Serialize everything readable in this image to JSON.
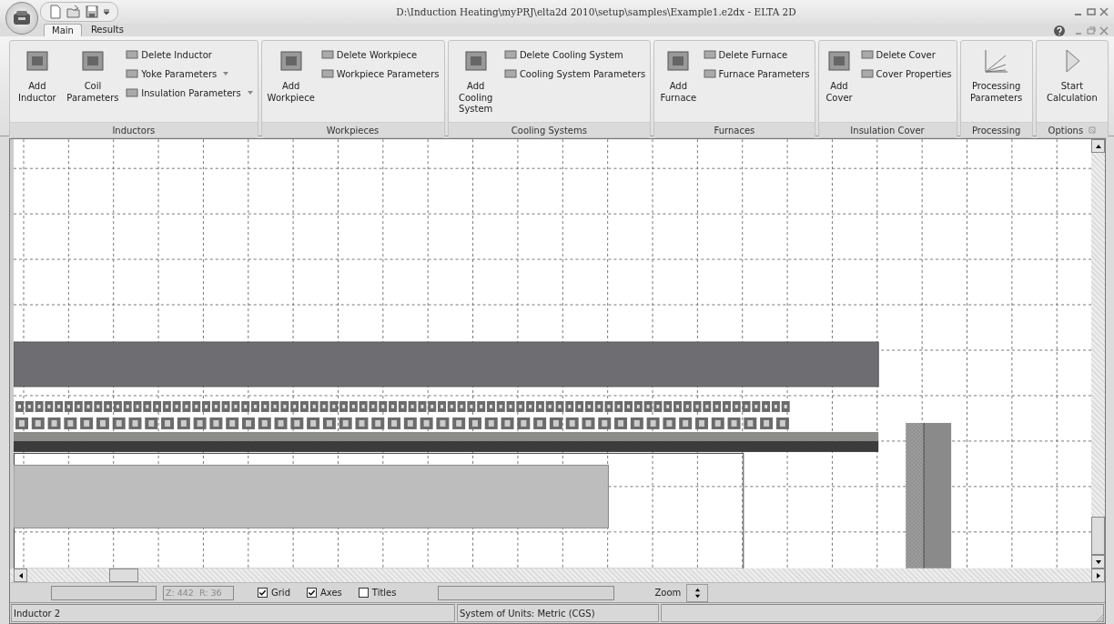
{
  "window": {
    "title": "D:\\Induction Heating\\myPRJ\\elta2d 2010\\setup\\samples\\Example1.e2dx - ELTA 2D"
  },
  "tabs": [
    {
      "label": "Main",
      "selected": true
    },
    {
      "label": "Results",
      "selected": false
    }
  ],
  "ribbon": [
    {
      "name": "Inductors",
      "items": [
        {
          "kind": "large",
          "label": "Add Inductor"
        },
        {
          "kind": "large",
          "label": "Coil Parameters"
        },
        {
          "kind": "small",
          "label": "Delete Inductor",
          "dropdown": false
        },
        {
          "kind": "small",
          "label": "Yoke Parameters",
          "dropdown": true
        },
        {
          "kind": "small",
          "label": "Insulation Parameters",
          "dropdown": true
        }
      ]
    },
    {
      "name": "Workpieces",
      "items": [
        {
          "kind": "large",
          "label": "Add Workpiece"
        },
        {
          "kind": "small",
          "label": "Delete Workpiece",
          "dropdown": false
        },
        {
          "kind": "small",
          "label": "Workpiece Parameters",
          "dropdown": false
        }
      ]
    },
    {
      "name": "Cooling Systems",
      "items": [
        {
          "kind": "large",
          "label": "Add Cooling System"
        },
        {
          "kind": "small",
          "label": "Delete Cooling System",
          "dropdown": false
        },
        {
          "kind": "small",
          "label": "Cooling System Parameters",
          "dropdown": false
        }
      ]
    },
    {
      "name": "Furnaces",
      "items": [
        {
          "kind": "large",
          "label": "Add Furnace"
        },
        {
          "kind": "small",
          "label": "Delete Furnace",
          "dropdown": false
        },
        {
          "kind": "small",
          "label": "Furnace Parameters",
          "dropdown": false
        }
      ]
    },
    {
      "name": "Insulation Cover",
      "items": [
        {
          "kind": "large",
          "label": "Add Cover"
        },
        {
          "kind": "small",
          "label": "Delete Cover",
          "dropdown": false
        },
        {
          "kind": "small",
          "label": "Cover Properties",
          "dropdown": false
        }
      ]
    },
    {
      "name": "Processing",
      "items": [
        {
          "kind": "large",
          "label": "Processing Parameters"
        }
      ]
    },
    {
      "name": "Options",
      "items": [
        {
          "kind": "large",
          "label": "Start Calculation"
        }
      ]
    }
  ],
  "toolbar": {
    "coordinates": "Z: 442  R: 36",
    "checkboxes": [
      {
        "label": "Grid",
        "checked": true
      },
      {
        "label": "Axes",
        "checked": true
      },
      {
        "label": "Titles",
        "checked": false
      }
    ],
    "zoom_label": "Zoom"
  },
  "status_bar": [
    "Inductor 2",
    "System of Units: Metric (CGS)"
  ]
}
